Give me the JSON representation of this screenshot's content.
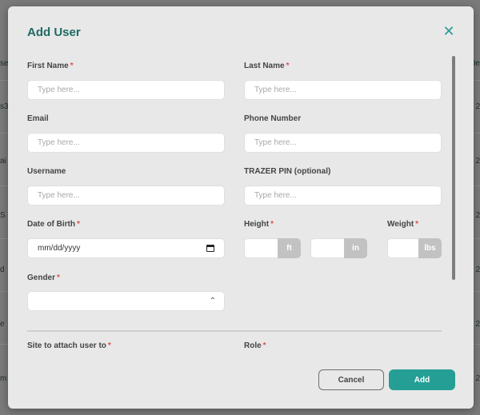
{
  "modal": {
    "title": "Add User",
    "close_icon": "close-icon",
    "accent_color": "#259f95",
    "fields": {
      "first_name": {
        "label": "First Name",
        "required": "*",
        "placeholder": "Type here..."
      },
      "last_name": {
        "label": "Last Name",
        "required": "*",
        "placeholder": "Type here..."
      },
      "email": {
        "label": "Email",
        "placeholder": "Type here..."
      },
      "phone": {
        "label": "Phone Number",
        "placeholder": "Type here..."
      },
      "username": {
        "label": "Username",
        "placeholder": "Type here..."
      },
      "trazer_pin": {
        "label": "TRAZER PIN (optional)",
        "placeholder": "Type here..."
      },
      "dob": {
        "label": "Date of Birth",
        "required": "*",
        "placeholder": "mm/dd/yyyy"
      },
      "height": {
        "label": "Height",
        "required": "*",
        "unit_ft": "ft",
        "unit_in": "in"
      },
      "weight": {
        "label": "Weight",
        "required": "*",
        "unit": "lbs"
      },
      "gender": {
        "label": "Gender",
        "required": "*",
        "value": ""
      },
      "site": {
        "label": "Site to attach user to",
        "required": "*"
      },
      "role": {
        "label": "Role",
        "required": "*"
      }
    },
    "buttons": {
      "cancel": "Cancel",
      "add": "Add"
    }
  },
  "background": {
    "fragments_left": [
      "se",
      "s3",
      "ai",
      "S",
      "d",
      "e",
      "m"
    ],
    "fragments_right": [
      "De",
      "2",
      "2",
      "2",
      "2",
      "2",
      "2"
    ]
  }
}
